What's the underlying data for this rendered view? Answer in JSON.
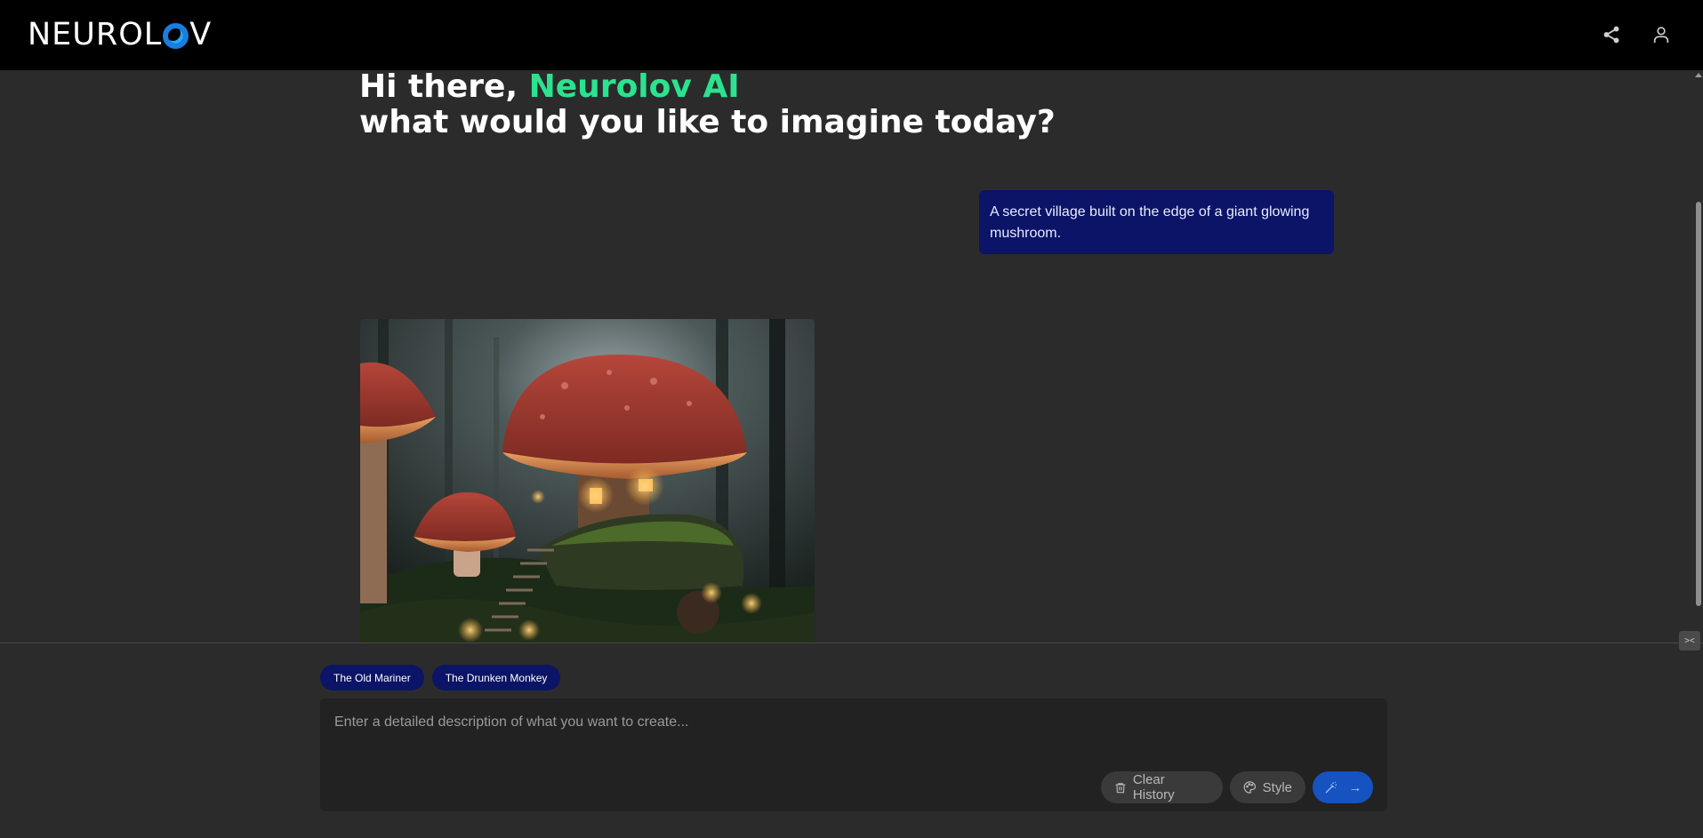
{
  "brand": {
    "logo_text_left": "NEUROL",
    "logo_text_right": "V"
  },
  "header": {
    "share_icon": "share-icon",
    "user_icon": "user-icon"
  },
  "hero": {
    "greeting": "Hi there, ",
    "name": "Neurolov AI",
    "question": "what would you like to imagine today?"
  },
  "chat": {
    "user_prompt": "A secret village built on the edge of a giant glowing mushroom."
  },
  "suggestions": [
    "The Old Mariner",
    "The Drunken Monkey"
  ],
  "composer": {
    "placeholder": "Enter a detailed description of what you want to create...",
    "clear_label": "Clear History",
    "style_label": "Style",
    "generate_arrow": "→"
  },
  "colors": {
    "accent_green": "#2be38f",
    "bubble_navy": "#0b1466",
    "generate_blue": "#1652c0",
    "background": "#2b2b2b"
  }
}
